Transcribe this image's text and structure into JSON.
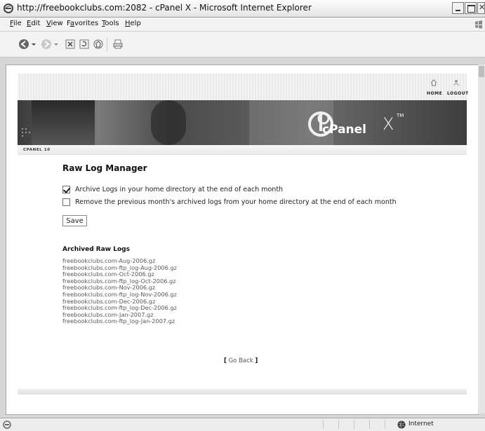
{
  "window": {
    "title": "http://freebookclubs.com:2082 - cPanel X - Microsoft Internet Explorer"
  },
  "menu": {
    "items": [
      {
        "key": "E",
        "rest": "ile"
      },
      {
        "key": "E",
        "rest": "dit"
      },
      {
        "key": "V",
        "rest": "iew"
      },
      {
        "key": "a",
        "pre": "F",
        "rest": "vorites"
      },
      {
        "key": "T",
        "rest": "ools"
      },
      {
        "key": "H",
        "rest": "elp"
      }
    ]
  },
  "cpanel_header": {
    "home_label": "HOME",
    "logout_label": "LOGOUT",
    "brand_word": "cPanel",
    "brand_mark": "X",
    "trademark": "TM",
    "breadcrumb": "CPANEL 10"
  },
  "page": {
    "title": "Raw Log Manager",
    "options": [
      {
        "label": "Archive Logs in your home directory at the end of each month",
        "checked": true
      },
      {
        "label": "Remove the previous month's archived logs from your home directory at the end of each month",
        "checked": false
      }
    ],
    "save_label": "Save",
    "archived_title": "Archived Raw Logs",
    "archived_logs": [
      "freebookclubs.com-Aug-2006.gz",
      "freebookclubs.com-ftp_log-Aug-2006.gz",
      "freebookclubs.com-Oct-2006.gz",
      "freebookclubs.com-ftp_log-Oct-2006.gz",
      "freebookclubs.com-Nov-2006.gz",
      "freebookclubs.com-ftp_log-Nov-2006.gz",
      "freebookclubs.com-Dec-2006.gz",
      "freebookclubs.com-ftp_log-Dec-2006.gz",
      "freebookclubs.com-Jan-2007.gz",
      "freebookclubs.com-ftp_log-Jan-2007.gz"
    ],
    "go_back_open": "[",
    "go_back_label": "Go Back",
    "go_back_close": "]"
  },
  "statusbar": {
    "zone": "Internet"
  }
}
